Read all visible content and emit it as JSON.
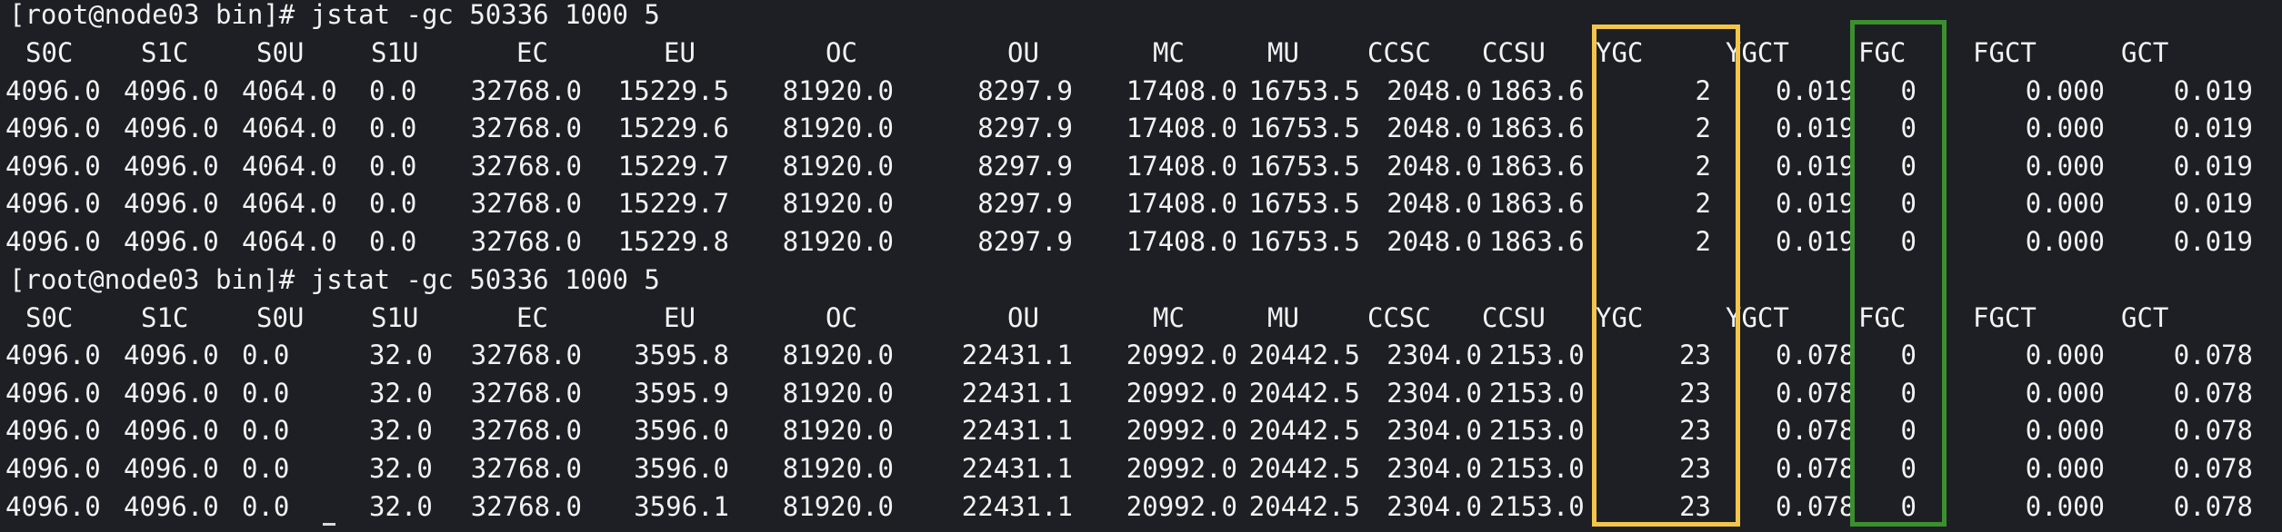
{
  "terminal": {
    "sessions": [
      {
        "prompt": "[root@node03 bin]# jstat -gc 50336 1000 5",
        "headers": [
          "S0C",
          "S1C",
          "S0U",
          "S1U",
          "EC",
          "EU",
          "OC",
          "OU",
          "MC",
          "MU",
          "CCSC",
          "CCSU",
          "YGC",
          "YGCT",
          "FGC",
          "FGCT",
          "GCT"
        ],
        "rows": [
          [
            "4096.0",
            "4096.0",
            "4064.0",
            "0.0",
            "32768.0",
            "15229.5",
            "81920.0",
            "8297.9",
            "17408.0",
            "16753.5",
            "2048.0",
            "1863.6",
            "2",
            "0.019",
            "0",
            "0.000",
            "0.019"
          ],
          [
            "4096.0",
            "4096.0",
            "4064.0",
            "0.0",
            "32768.0",
            "15229.6",
            "81920.0",
            "8297.9",
            "17408.0",
            "16753.5",
            "2048.0",
            "1863.6",
            "2",
            "0.019",
            "0",
            "0.000",
            "0.019"
          ],
          [
            "4096.0",
            "4096.0",
            "4064.0",
            "0.0",
            "32768.0",
            "15229.7",
            "81920.0",
            "8297.9",
            "17408.0",
            "16753.5",
            "2048.0",
            "1863.6",
            "2",
            "0.019",
            "0",
            "0.000",
            "0.019"
          ],
          [
            "4096.0",
            "4096.0",
            "4064.0",
            "0.0",
            "32768.0",
            "15229.7",
            "81920.0",
            "8297.9",
            "17408.0",
            "16753.5",
            "2048.0",
            "1863.6",
            "2",
            "0.019",
            "0",
            "0.000",
            "0.019"
          ],
          [
            "4096.0",
            "4096.0",
            "4064.0",
            "0.0",
            "32768.0",
            "15229.8",
            "81920.0",
            "8297.9",
            "17408.0",
            "16753.5",
            "2048.0",
            "1863.6",
            "2",
            "0.019",
            "0",
            "0.000",
            "0.019"
          ]
        ]
      },
      {
        "prompt": "[root@node03 bin]# jstat -gc 50336 1000 5",
        "headers": [
          "S0C",
          "S1C",
          "S0U",
          "S1U",
          "EC",
          "EU",
          "OC",
          "OU",
          "MC",
          "MU",
          "CCSC",
          "CCSU",
          "YGC",
          "YGCT",
          "FGC",
          "FGCT",
          "GCT"
        ],
        "rows": [
          [
            "4096.0",
            "4096.0",
            "0.0",
            "32.0",
            "32768.0",
            "3595.8",
            "81920.0",
            "22431.1",
            "20992.0",
            "20442.5",
            "2304.0",
            "2153.0",
            "23",
            "0.078",
            "0",
            "0.000",
            "0.078"
          ],
          [
            "4096.0",
            "4096.0",
            "0.0",
            "32.0",
            "32768.0",
            "3595.9",
            "81920.0",
            "22431.1",
            "20992.0",
            "20442.5",
            "2304.0",
            "2153.0",
            "23",
            "0.078",
            "0",
            "0.000",
            "0.078"
          ],
          [
            "4096.0",
            "4096.0",
            "0.0",
            "32.0",
            "32768.0",
            "3596.0",
            "81920.0",
            "22431.1",
            "20992.0",
            "20442.5",
            "2304.0",
            "2153.0",
            "23",
            "0.078",
            "0",
            "0.000",
            "0.078"
          ],
          [
            "4096.0",
            "4096.0",
            "0.0",
            "32.0",
            "32768.0",
            "3596.0",
            "81920.0",
            "22431.1",
            "20992.0",
            "20442.5",
            "2304.0",
            "2153.0",
            "23",
            "0.078",
            "0",
            "0.000",
            "0.078"
          ],
          [
            "4096.0",
            "4096.0",
            "0.0",
            "32.0",
            "32768.0",
            "3596.1",
            "81920.0",
            "22431.1",
            "20992.0",
            "20442.5",
            "2304.0",
            "2153.0",
            "23",
            "0.078",
            "0",
            "0.000",
            "0.078"
          ]
        ]
      }
    ]
  },
  "colors": {
    "background": "#1e1f24",
    "text": "#f2f2f2",
    "ygc_highlight": "#f3c54b",
    "fgc_highlight": "#3c8f2e"
  }
}
